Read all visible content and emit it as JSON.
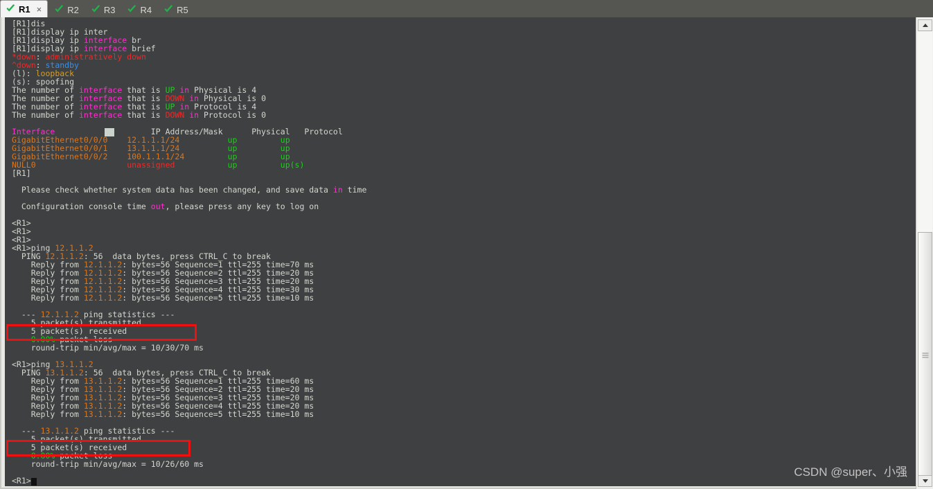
{
  "window": {
    "tabs": [
      {
        "label": "R1",
        "active": true,
        "icon": "green-check-icon",
        "closable": true
      },
      {
        "label": "R2",
        "active": false,
        "icon": "green-check-icon",
        "closable": false
      },
      {
        "label": "R3",
        "active": false,
        "icon": "green-check-icon",
        "closable": false
      },
      {
        "label": "R4",
        "active": false,
        "icon": "green-check-icon",
        "closable": false
      },
      {
        "label": "R5",
        "active": false,
        "icon": "green-check-icon",
        "closable": false
      }
    ],
    "close_symbol": "×"
  },
  "colors": {
    "terminal_bg": "#3f4041",
    "tabbar_bg": "#555552",
    "active_tab_bg": "#f3f3f3",
    "default_text": "#d3d7cf",
    "magenta": "#ff2fd0",
    "red": "#ef2929",
    "orange": "#d97820",
    "green": "#18d218",
    "blue": "#3b8fe8",
    "amber": "#d9a020",
    "annotation": "#f01010"
  },
  "terminal": {
    "prompt_config": "[R1]",
    "prompt_user": "<R1>",
    "lines": [
      {
        "id": "l01",
        "segs": [
          {
            "t": "[R1]dis",
            "c": "c-w"
          }
        ]
      },
      {
        "id": "l02",
        "segs": [
          {
            "t": "[R1]display ip inter",
            "c": "c-w"
          }
        ]
      },
      {
        "id": "l03",
        "segs": [
          {
            "t": "[R1]display ip ",
            "c": "c-w"
          },
          {
            "t": "interface",
            "c": "c-m"
          },
          {
            "t": " br",
            "c": "c-w"
          }
        ]
      },
      {
        "id": "l04",
        "segs": [
          {
            "t": "[R1]display ip ",
            "c": "c-w"
          },
          {
            "t": "interface",
            "c": "c-m"
          },
          {
            "t": " brief",
            "c": "c-w"
          }
        ]
      },
      {
        "id": "l05",
        "segs": [
          {
            "t": "*down",
            "c": "c-r"
          },
          {
            "t": ": ",
            "c": "c-w"
          },
          {
            "t": "administratively down",
            "c": "c-r"
          }
        ]
      },
      {
        "id": "l06",
        "segs": [
          {
            "t": "^down",
            "c": "c-r"
          },
          {
            "t": ": ",
            "c": "c-w"
          },
          {
            "t": "standby",
            "c": "c-b"
          }
        ]
      },
      {
        "id": "l07",
        "segs": [
          {
            "t": "(l): ",
            "c": "c-w"
          },
          {
            "t": "loopback",
            "c": "c-y"
          }
        ]
      },
      {
        "id": "l08",
        "segs": [
          {
            "t": "(s): spoofing",
            "c": "c-w"
          }
        ]
      },
      {
        "id": "l09",
        "segs": [
          {
            "t": "The number of ",
            "c": "c-w"
          },
          {
            "t": "interface",
            "c": "c-m"
          },
          {
            "t": " that is ",
            "c": "c-w"
          },
          {
            "t": "UP",
            "c": "c-g"
          },
          {
            "t": " ",
            "c": "c-w"
          },
          {
            "t": "in",
            "c": "c-m"
          },
          {
            "t": " Physical is 4",
            "c": "c-w"
          }
        ]
      },
      {
        "id": "l10",
        "segs": [
          {
            "t": "The number of ",
            "c": "c-w"
          },
          {
            "t": "interface",
            "c": "c-m"
          },
          {
            "t": " that is ",
            "c": "c-w"
          },
          {
            "t": "DOWN",
            "c": "c-r"
          },
          {
            "t": " ",
            "c": "c-w"
          },
          {
            "t": "in",
            "c": "c-m"
          },
          {
            "t": " Physical is 0",
            "c": "c-w"
          }
        ]
      },
      {
        "id": "l11",
        "segs": [
          {
            "t": "The number of ",
            "c": "c-w"
          },
          {
            "t": "interface",
            "c": "c-m"
          },
          {
            "t": " that is ",
            "c": "c-w"
          },
          {
            "t": "UP",
            "c": "c-g"
          },
          {
            "t": " ",
            "c": "c-w"
          },
          {
            "t": "in",
            "c": "c-m"
          },
          {
            "t": " Protocol is 4",
            "c": "c-w"
          }
        ]
      },
      {
        "id": "l12",
        "segs": [
          {
            "t": "The number of ",
            "c": "c-w"
          },
          {
            "t": "interface",
            "c": "c-m"
          },
          {
            "t": " that is ",
            "c": "c-w"
          },
          {
            "t": "DOWN",
            "c": "c-r"
          },
          {
            "t": " ",
            "c": "c-w"
          },
          {
            "t": "in",
            "c": "c-m"
          },
          {
            "t": " Protocol is 0",
            "c": "c-w"
          }
        ]
      },
      {
        "id": "l13",
        "segs": [
          {
            "t": "",
            "c": "c-w"
          }
        ]
      },
      {
        "id": "l14",
        "segs": [
          {
            "t": "Interface",
            "c": "c-m"
          },
          {
            "t": "                    ",
            "c": "c-w"
          },
          {
            "t": "IP Address/Mask      Physical   Protocol",
            "c": "c-w"
          }
        ],
        "cursor_block": true
      },
      {
        "id": "l15",
        "segs": [
          {
            "t": "GigabitEthernet0/0/0",
            "c": "c-o"
          },
          {
            "t": "    ",
            "c": "c-w"
          },
          {
            "t": "12.1.1.1/24",
            "c": "c-o"
          },
          {
            "t": "          ",
            "c": "c-w"
          },
          {
            "t": "up",
            "c": "c-g"
          },
          {
            "t": "         ",
            "c": "c-w"
          },
          {
            "t": "up",
            "c": "c-g"
          }
        ]
      },
      {
        "id": "l16",
        "segs": [
          {
            "t": "GigabitEthernet0/0/1",
            "c": "c-o"
          },
          {
            "t": "    ",
            "c": "c-w"
          },
          {
            "t": "13.1.1.1/24",
            "c": "c-o"
          },
          {
            "t": "          ",
            "c": "c-w"
          },
          {
            "t": "up",
            "c": "c-g"
          },
          {
            "t": "         ",
            "c": "c-w"
          },
          {
            "t": "up",
            "c": "c-g"
          }
        ]
      },
      {
        "id": "l17",
        "segs": [
          {
            "t": "GigabitEthernet0/0/2",
            "c": "c-o"
          },
          {
            "t": "    ",
            "c": "c-w"
          },
          {
            "t": "100.1.1.1/24",
            "c": "c-o"
          },
          {
            "t": "         ",
            "c": "c-w"
          },
          {
            "t": "up",
            "c": "c-g"
          },
          {
            "t": "         ",
            "c": "c-w"
          },
          {
            "t": "up",
            "c": "c-g"
          }
        ]
      },
      {
        "id": "l18",
        "segs": [
          {
            "t": "NULL0",
            "c": "c-o"
          },
          {
            "t": "                   ",
            "c": "c-w"
          },
          {
            "t": "unassigned",
            "c": "c-r"
          },
          {
            "t": "           ",
            "c": "c-w"
          },
          {
            "t": "up",
            "c": "c-g"
          },
          {
            "t": "         ",
            "c": "c-g"
          },
          {
            "t": "up(s)",
            "c": "c-g"
          }
        ]
      },
      {
        "id": "l19",
        "segs": [
          {
            "t": "[R1]",
            "c": "c-w"
          }
        ]
      },
      {
        "id": "l20",
        "segs": [
          {
            "t": "",
            "c": "c-w"
          }
        ]
      },
      {
        "id": "l21",
        "segs": [
          {
            "t": "  Please check whether system data has been changed, and save data ",
            "c": "c-w"
          },
          {
            "t": "in",
            "c": "c-m"
          },
          {
            "t": " time",
            "c": "c-w"
          }
        ]
      },
      {
        "id": "l22",
        "segs": [
          {
            "t": "",
            "c": "c-w"
          }
        ]
      },
      {
        "id": "l23",
        "segs": [
          {
            "t": "  Configuration console time ",
            "c": "c-w"
          },
          {
            "t": "out",
            "c": "c-m"
          },
          {
            "t": ", please press any key to log on",
            "c": "c-w"
          }
        ]
      },
      {
        "id": "l24",
        "segs": [
          {
            "t": "",
            "c": "c-w"
          }
        ]
      },
      {
        "id": "l25",
        "segs": [
          {
            "t": "<R1>",
            "c": "c-w"
          }
        ]
      },
      {
        "id": "l26",
        "segs": [
          {
            "t": "<R1>",
            "c": "c-w"
          }
        ]
      },
      {
        "id": "l27",
        "segs": [
          {
            "t": "<R1>",
            "c": "c-w"
          }
        ]
      },
      {
        "id": "l28",
        "segs": [
          {
            "t": "<R1>ping ",
            "c": "c-w"
          },
          {
            "t": "12.1.1.2",
            "c": "c-o"
          }
        ]
      },
      {
        "id": "l29",
        "segs": [
          {
            "t": "  PING ",
            "c": "c-w"
          },
          {
            "t": "12.1.1.2",
            "c": "c-o"
          },
          {
            "t": ": 56  data bytes, press CTRL_C to break",
            "c": "c-w"
          }
        ]
      },
      {
        "id": "l30",
        "segs": [
          {
            "t": "    Reply from ",
            "c": "c-w"
          },
          {
            "t": "12.1.1.2",
            "c": "c-o"
          },
          {
            "t": ": bytes=56 Sequence=1 ttl=255 time=70 ms",
            "c": "c-w"
          }
        ]
      },
      {
        "id": "l31",
        "segs": [
          {
            "t": "    Reply from ",
            "c": "c-w"
          },
          {
            "t": "12.1.1.2",
            "c": "c-o"
          },
          {
            "t": ": bytes=56 Sequence=2 ttl=255 time=20 ms",
            "c": "c-w"
          }
        ]
      },
      {
        "id": "l32",
        "segs": [
          {
            "t": "    Reply from ",
            "c": "c-w"
          },
          {
            "t": "12.1.1.2",
            "c": "c-o"
          },
          {
            "t": ": bytes=56 Sequence=3 ttl=255 time=20 ms",
            "c": "c-w"
          }
        ]
      },
      {
        "id": "l33",
        "segs": [
          {
            "t": "    Reply from ",
            "c": "c-w"
          },
          {
            "t": "12.1.1.2",
            "c": "c-o"
          },
          {
            "t": ": bytes=56 Sequence=4 ttl=255 time=30 ms",
            "c": "c-w"
          }
        ]
      },
      {
        "id": "l34",
        "segs": [
          {
            "t": "    Reply from ",
            "c": "c-w"
          },
          {
            "t": "12.1.1.2",
            "c": "c-o"
          },
          {
            "t": ": bytes=56 Sequence=5 ttl=255 time=10 ms",
            "c": "c-w"
          }
        ]
      },
      {
        "id": "l35",
        "segs": [
          {
            "t": "",
            "c": "c-w"
          }
        ]
      },
      {
        "id": "l36",
        "segs": [
          {
            "t": "  --- ",
            "c": "c-w"
          },
          {
            "t": "12.1.1.2",
            "c": "c-o"
          },
          {
            "t": " ping statistics ---",
            "c": "c-w"
          }
        ]
      },
      {
        "id": "l37",
        "segs": [
          {
            "t": "    5 packet(s) transmitted",
            "c": "c-w"
          }
        ]
      },
      {
        "id": "l38",
        "segs": [
          {
            "t": "    5 packet(s) received",
            "c": "c-w"
          }
        ]
      },
      {
        "id": "l39",
        "segs": [
          {
            "t": "    ",
            "c": "c-w"
          },
          {
            "t": "0.00%",
            "c": "c-g"
          },
          {
            "t": " packet loss",
            "c": "c-w"
          }
        ]
      },
      {
        "id": "l40",
        "segs": [
          {
            "t": "    round-trip min/avg/max = 10/30/70 ms",
            "c": "c-w"
          }
        ]
      },
      {
        "id": "l41",
        "segs": [
          {
            "t": "",
            "c": "c-w"
          }
        ]
      },
      {
        "id": "l42",
        "segs": [
          {
            "t": "<R1>ping ",
            "c": "c-w"
          },
          {
            "t": "13.1.1.2",
            "c": "c-o"
          }
        ]
      },
      {
        "id": "l43",
        "segs": [
          {
            "t": "  PING ",
            "c": "c-w"
          },
          {
            "t": "13.1.1.2",
            "c": "c-o"
          },
          {
            "t": ": 56  data bytes, press CTRL_C to break",
            "c": "c-w"
          }
        ]
      },
      {
        "id": "l44",
        "segs": [
          {
            "t": "    Reply from ",
            "c": "c-w"
          },
          {
            "t": "13.1.1.2",
            "c": "c-o"
          },
          {
            "t": ": bytes=56 Sequence=1 ttl=255 time=60 ms",
            "c": "c-w"
          }
        ]
      },
      {
        "id": "l45",
        "segs": [
          {
            "t": "    Reply from ",
            "c": "c-w"
          },
          {
            "t": "13.1.1.2",
            "c": "c-o"
          },
          {
            "t": ": bytes=56 Sequence=2 ttl=255 time=20 ms",
            "c": "c-w"
          }
        ]
      },
      {
        "id": "l46",
        "segs": [
          {
            "t": "    Reply from ",
            "c": "c-w"
          },
          {
            "t": "13.1.1.2",
            "c": "c-o"
          },
          {
            "t": ": bytes=56 Sequence=3 ttl=255 time=20 ms",
            "c": "c-w"
          }
        ]
      },
      {
        "id": "l47",
        "segs": [
          {
            "t": "    Reply from ",
            "c": "c-w"
          },
          {
            "t": "13.1.1.2",
            "c": "c-o"
          },
          {
            "t": ": bytes=56 Sequence=4 ttl=255 time=20 ms",
            "c": "c-w"
          }
        ]
      },
      {
        "id": "l48",
        "segs": [
          {
            "t": "    Reply from ",
            "c": "c-w"
          },
          {
            "t": "13.1.1.2",
            "c": "c-o"
          },
          {
            "t": ": bytes=56 Sequence=5 ttl=255 time=10 ms",
            "c": "c-w"
          }
        ]
      },
      {
        "id": "l49",
        "segs": [
          {
            "t": "",
            "c": "c-w"
          }
        ]
      },
      {
        "id": "l50",
        "segs": [
          {
            "t": "  --- ",
            "c": "c-w"
          },
          {
            "t": "13.1.1.2",
            "c": "c-o"
          },
          {
            "t": " ping statistics ---",
            "c": "c-w"
          }
        ]
      },
      {
        "id": "l51",
        "segs": [
          {
            "t": "    5 packet(s) transmitted",
            "c": "c-w"
          }
        ]
      },
      {
        "id": "l52",
        "segs": [
          {
            "t": "    5 packet(s) received",
            "c": "c-w"
          }
        ]
      },
      {
        "id": "l53",
        "segs": [
          {
            "t": "    ",
            "c": "c-w"
          },
          {
            "t": "0.00%",
            "c": "c-g"
          },
          {
            "t": " packet loss",
            "c": "c-w"
          }
        ]
      },
      {
        "id": "l54",
        "segs": [
          {
            "t": "    round-trip min/avg/max = 10/26/60 ms",
            "c": "c-w"
          }
        ]
      },
      {
        "id": "l55",
        "segs": [
          {
            "t": "",
            "c": "c-w"
          }
        ]
      },
      {
        "id": "l56",
        "segs": [
          {
            "t": "<R1>",
            "c": "c-w"
          }
        ],
        "cursor_caret": true
      }
    ]
  },
  "annotations": [
    {
      "id": "annot-1",
      "target": "12.1.1.2 ping statistics"
    },
    {
      "id": "annot-2",
      "target": "13.1.1.2 ping statistics"
    }
  ],
  "watermark": {
    "text": "CSDN @super、小强"
  },
  "scrollbar": {
    "up_label": "▲",
    "down_label": "▼"
  }
}
